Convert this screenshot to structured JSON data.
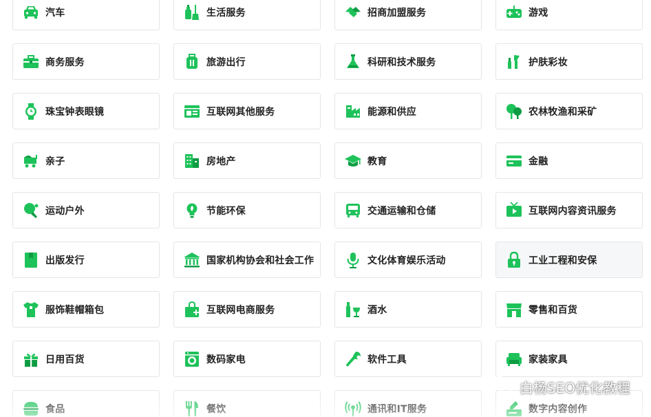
{
  "accent_color": "#1ec25a",
  "categories": [
    {
      "label": "汽车",
      "icon": "car-icon"
    },
    {
      "label": "生活服务",
      "icon": "cleaning-supplies-icon"
    },
    {
      "label": "招商加盟服务",
      "icon": "handshake-icon"
    },
    {
      "label": "游戏",
      "icon": "gamepad-icon"
    },
    {
      "label": "商务服务",
      "icon": "briefcase-icon"
    },
    {
      "label": "旅游出行",
      "icon": "luggage-icon"
    },
    {
      "label": "科研和技术服务",
      "icon": "flask-icon"
    },
    {
      "label": "护肤彩妆",
      "icon": "cosmetics-icon"
    },
    {
      "label": "珠宝钟表眼镜",
      "icon": "watch-icon"
    },
    {
      "label": "互联网其他服务",
      "icon": "browser-window-icon"
    },
    {
      "label": "能源和供应",
      "icon": "factory-icon"
    },
    {
      "label": "农林牧渔和采矿",
      "icon": "tree-icon"
    },
    {
      "label": "亲子",
      "icon": "baby-stroller-icon"
    },
    {
      "label": "房地产",
      "icon": "building-icon"
    },
    {
      "label": "教育",
      "icon": "graduation-cap-icon"
    },
    {
      "label": "金融",
      "icon": "credit-card-icon"
    },
    {
      "label": "运动户外",
      "icon": "ping-pong-icon"
    },
    {
      "label": "节能环保",
      "icon": "eco-bulb-icon"
    },
    {
      "label": "交通运输和仓储",
      "icon": "bus-icon"
    },
    {
      "label": "互联网内容资讯服务",
      "icon": "tv-icon"
    },
    {
      "label": "出版发行",
      "icon": "book-icon"
    },
    {
      "label": "国家机构协会和社会工作",
      "icon": "government-building-icon"
    },
    {
      "label": "文化体育娱乐活动",
      "icon": "microphone-icon"
    },
    {
      "label": "工业工程和安保",
      "icon": "lock-icon"
    },
    {
      "label": "服饰鞋帽箱包",
      "icon": "shirt-icon"
    },
    {
      "label": "互联网电商服务",
      "icon": "shopping-bag-icon"
    },
    {
      "label": "酒水",
      "icon": "wine-icon"
    },
    {
      "label": "零售和百货",
      "icon": "store-icon"
    },
    {
      "label": "日用百货",
      "icon": "gift-box-icon"
    },
    {
      "label": "数码家电",
      "icon": "washing-machine-icon"
    },
    {
      "label": "软件工具",
      "icon": "wrench-icon"
    },
    {
      "label": "家装家具",
      "icon": "armchair-icon"
    },
    {
      "label": "食品",
      "icon": "burger-icon"
    },
    {
      "label": "餐饮",
      "icon": "utensils-icon"
    },
    {
      "label": "通讯和IT服务",
      "icon": "signal-tower-icon"
    },
    {
      "label": "数字内容创作",
      "icon": "pen-screen-icon"
    }
  ],
  "hovered_index": 23,
  "watermark": {
    "text": "白杨SEO优化教程",
    "icon": "wechat-logo-icon"
  }
}
